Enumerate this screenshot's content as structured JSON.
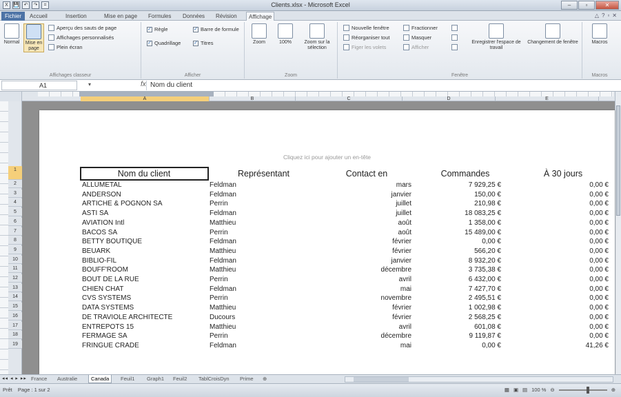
{
  "window": {
    "title": "Clients.xlsx - Microsoft Excel",
    "controls": {
      "minimize": "–",
      "maximize": "▫",
      "close": "✕"
    }
  },
  "quick_access": [
    "X",
    "💾",
    "↶",
    "↷",
    "="
  ],
  "ribbon_tabs": [
    "Fichier",
    "Accueil",
    "Insertion",
    "Mise en page",
    "Formules",
    "Données",
    "Révision",
    "Affichage"
  ],
  "active_tab": "Affichage",
  "ribbon": {
    "classeur": {
      "label": "Affichages classeur",
      "normal": "Normal",
      "mise_en_page": "Mise en page",
      "apercu": "Aperçu des sauts de page",
      "perso": "Affichages personnalisés",
      "plein_ecran": "Plein écran"
    },
    "afficher": {
      "label": "Afficher",
      "regle": "Règle",
      "quadrillage": "Quadrillage",
      "barre_formule": "Barre de formule",
      "titres": "Titres"
    },
    "zoom": {
      "label": "Zoom",
      "zoom": "Zoom",
      "cent": "100%",
      "selection": "Zoom sur la sélection"
    },
    "fenetre": {
      "label": "Fenêtre",
      "nouvelle": "Nouvelle fenêtre",
      "reorganiser": "Réorganiser tout",
      "figer": "Figer les volets",
      "fractionner": "Fractionner",
      "masquer": "Masquer",
      "afficher": "Afficher",
      "enregistrer": "Enregistrer l'espace de travail",
      "changement": "Changement de fenêtre"
    },
    "macros": {
      "label": "Macros",
      "macros": "Macros"
    }
  },
  "formula_bar": {
    "cell": "A1",
    "fx": "fx",
    "content": "Nom du client"
  },
  "columns": [
    "A",
    "B",
    "C",
    "D",
    "E"
  ],
  "page": {
    "header_hint": "Cliquez ici pour ajouter un en-tête"
  },
  "table": {
    "headers": [
      "Nom du client",
      "Représentant",
      "Contact en",
      "Commandes",
      "À 30 jours"
    ],
    "rows": [
      [
        "ALLUMETAL",
        "Feldman",
        "mars",
        "7 929,25 €",
        "0,00 €"
      ],
      [
        "ANDERSON",
        "Feldman",
        "janvier",
        "150,00 €",
        "0,00 €"
      ],
      [
        "ARTICHE & POGNON SA",
        "Perrin",
        "juillet",
        "210,98 €",
        "0,00 €"
      ],
      [
        "ASTI SA",
        "Feldman",
        "juillet",
        "18 083,25 €",
        "0,00 €"
      ],
      [
        "AVIATION Intl",
        "Matthieu",
        "août",
        "1 358,00 €",
        "0,00 €"
      ],
      [
        "BACOS SA",
        "Perrin",
        "août",
        "15 489,00 €",
        "0,00 €"
      ],
      [
        "BETTY BOUTIQUE",
        "Feldman",
        "février",
        "0,00 €",
        "0,00 €"
      ],
      [
        "BEUARK",
        "Matthieu",
        "février",
        "566,20 €",
        "0,00 €"
      ],
      [
        "BIBLIO-FIL",
        "Feldman",
        "janvier",
        "8 932,20 €",
        "0,00 €"
      ],
      [
        "BOUFF'ROOM",
        "Matthieu",
        "décembre",
        "3 735,38 €",
        "0,00 €"
      ],
      [
        "BOUT DE LA RUE",
        "Perrin",
        "avril",
        "6 432,00 €",
        "0,00 €"
      ],
      [
        "CHIEN CHAT",
        "Feldman",
        "mai",
        "7 427,70 €",
        "0,00 €"
      ],
      [
        "CVS SYSTEMS",
        "Perrin",
        "novembre",
        "2 495,51 €",
        "0,00 €"
      ],
      [
        "DATA SYSTEMS",
        "Matthieu",
        "février",
        "1 002,98 €",
        "0,00 €"
      ],
      [
        "DE TRAVIOLE ARCHITECTE",
        "Ducours",
        "février",
        "2 568,25 €",
        "0,00 €"
      ],
      [
        "ENTREPOTS 15",
        "Matthieu",
        "avril",
        "601,08 €",
        "0,00 €"
      ],
      [
        "FERMAGE SA",
        "Perrin",
        "décembre",
        "9 119,87 €",
        "0,00 €"
      ],
      [
        "FRINGUE CRADE",
        "Feldman",
        "mai",
        "0,00 €",
        "41,26 €"
      ]
    ]
  },
  "row_numbers": [
    "1",
    "2",
    "3",
    "4",
    "5",
    "6",
    "7",
    "8",
    "9",
    "10",
    "11",
    "12",
    "13",
    "14",
    "15",
    "16",
    "17",
    "18",
    "19"
  ],
  "sheet_tabs": [
    "France",
    "Australie",
    "Canada",
    "Feuil1",
    "Graph1",
    "Feuil2",
    "TablCroisDyn",
    "Prime"
  ],
  "active_sheet": "Canada",
  "status": {
    "mode": "Prêt",
    "page": "Page : 1 sur 2",
    "zoom": "100 %"
  },
  "colors": {
    "file_tab": "#4d73a6",
    "selection": "#f5cf7a"
  }
}
